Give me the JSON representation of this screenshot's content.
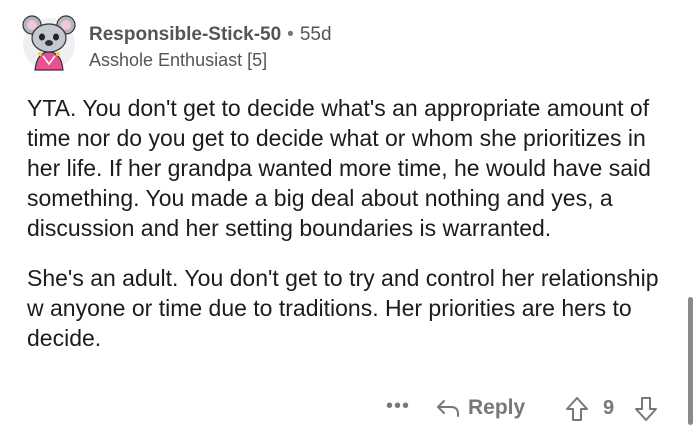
{
  "comment": {
    "username": "Responsible-Stick-50",
    "separator": "•",
    "age": "55d",
    "flair": "Asshole Enthusiast [5]",
    "paragraphs": [
      "YTA. You don't get to decide what's an appropriate amount of time nor do you get to decide what or whom she prioritizes in her life. If her grandpa wanted more time, he would have said something. You made a big deal about nothing and yes, a discussion and her setting boundaries is warranted.",
      "She's an adult. You don't get to try and control her relationship w anyone or time due to traditions. Her priorities are hers to decide."
    ]
  },
  "actions": {
    "more_label": "•••",
    "reply_label": "Reply",
    "score": "9",
    "icons": [
      "avatar-koala",
      "more-icon",
      "reply-arrow-icon",
      "upvote-icon",
      "downvote-icon"
    ]
  },
  "colors": {
    "text": "#1c1c1c",
    "meta": "#555555",
    "action": "#777777",
    "scrollbar": "#8a8a8a"
  }
}
